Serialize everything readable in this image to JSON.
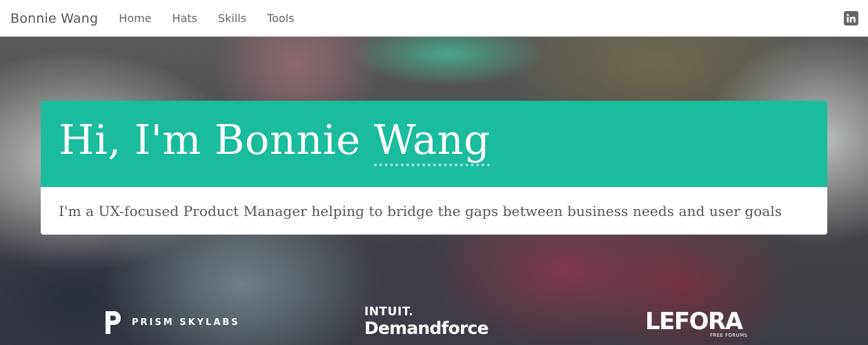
{
  "nav": {
    "brand": "Bonnie Wang",
    "links": [
      {
        "label": "Home"
      },
      {
        "label": "Hats"
      },
      {
        "label": "Skills"
      },
      {
        "label": "Tools"
      }
    ],
    "social_icon": "linkedin-icon"
  },
  "hero": {
    "headline_prefix": "Hi, I'm Bonnie ",
    "headline_name": "Wang",
    "tagline": "I'm a UX-focused Product Manager helping to bridge the gaps between business needs and user goals",
    "accent_color": "#1abc9c"
  },
  "logos": {
    "prism": {
      "text": "PRISM SKYLABS"
    },
    "intuit": {
      "small": "INTUIT.",
      "big": "Demandforce"
    },
    "lefora": {
      "text": "LEFORA",
      "sub": "FREE FORUMS"
    }
  }
}
